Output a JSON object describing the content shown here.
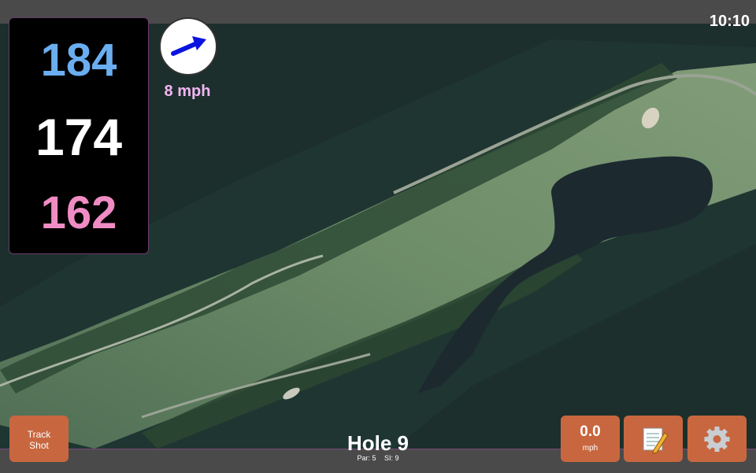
{
  "status": {
    "time": "10:10"
  },
  "distances": {
    "back": "184",
    "middle": "174",
    "front": "162"
  },
  "wind": {
    "speed": "8 mph",
    "icon": "wind-direction-arrow-icon"
  },
  "buttons": {
    "track_shot_line1": "Track",
    "track_shot_line2": "Shot",
    "speed_value": "0.0",
    "speed_unit": "mph",
    "notes_icon": "memo-icon",
    "settings_icon": "gear-icon"
  },
  "hole": {
    "title": "Hole 9",
    "par": "Par: 5",
    "si": "SI: 9"
  },
  "colors": {
    "accent": "#c8673f",
    "back": "#6aaef0",
    "middle": "#ffffff",
    "front": "#f08cc4",
    "wind_text": "#f3b6f3",
    "arrow": "#0a14e0"
  }
}
